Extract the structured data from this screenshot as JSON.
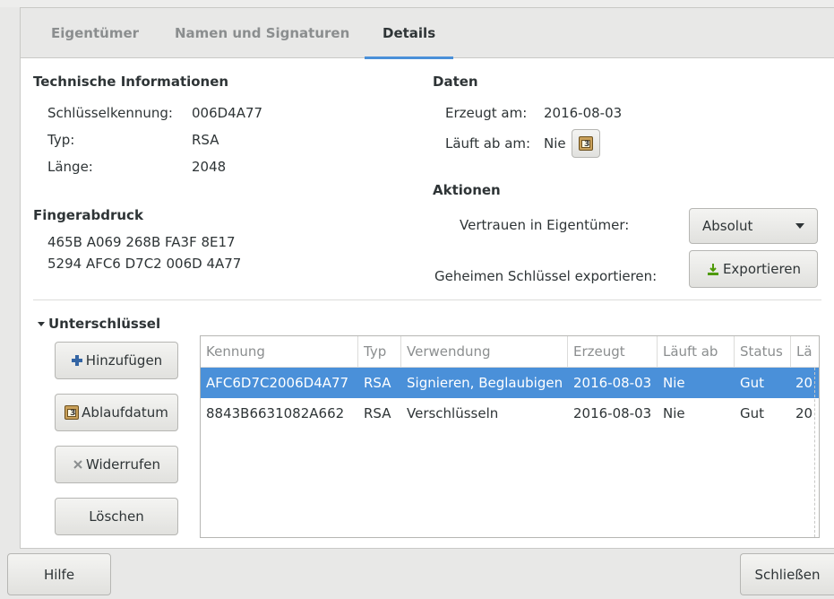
{
  "tabs": [
    {
      "label": "Eigentümer"
    },
    {
      "label": "Namen und Signaturen"
    },
    {
      "label": "Details"
    }
  ],
  "technical": {
    "heading": "Technische Informationen",
    "keyid_label": "Schlüsselkennung:",
    "keyid_value": "006D4A77",
    "type_label": "Typ:",
    "type_value": "RSA",
    "length_label": "Länge:",
    "length_value": "2048"
  },
  "fingerprint": {
    "heading": "Fingerabdruck",
    "line1": "465B A069 268B FA3F 8E17",
    "line2": "5294 AFC6 D7C2 006D 4A77"
  },
  "dates": {
    "heading": "Daten",
    "created_label": "Erzeugt am:",
    "created_value": "2016-08-03",
    "expires_label": "Läuft ab am:",
    "expires_value": "Nie",
    "expires_button_icon": "calendar-icon"
  },
  "actions": {
    "heading": "Aktionen",
    "trust_label": "Vertrauen in Eigentümer:",
    "trust_value": "Absolut",
    "export_label": "Geheimen Schlüssel exportieren:",
    "export_button": "Exportieren",
    "export_icon": "export-icon"
  },
  "subkeys": {
    "heading": "Unterschlüssel",
    "buttons": {
      "add": "Hinzufügen",
      "expiry": "Ablaufdatum",
      "revoke": "Widerrufen",
      "delete": "Löschen"
    },
    "columns": [
      "Kennung",
      "Typ",
      "Verwendung",
      "Erzeugt",
      "Läuft ab",
      "Status",
      "Lä"
    ],
    "rows": [
      {
        "id": "AFC6D7C2006D4A77",
        "type": "RSA",
        "usage": "Signieren, Beglaubigen",
        "created": "2016-08-03",
        "expires": "Nie",
        "status": "Gut",
        "length": "20",
        "selected": true
      },
      {
        "id": "8843B6631082A662",
        "type": "RSA",
        "usage": "Verschlüsseln",
        "created": "2016-08-03",
        "expires": "Nie",
        "status": "Gut",
        "length": "20",
        "selected": false
      }
    ]
  },
  "footer": {
    "help": "Hilfe",
    "close": "Schließen"
  },
  "colors": {
    "accent": "#4a90d9",
    "selection_text": "#ffffff"
  }
}
